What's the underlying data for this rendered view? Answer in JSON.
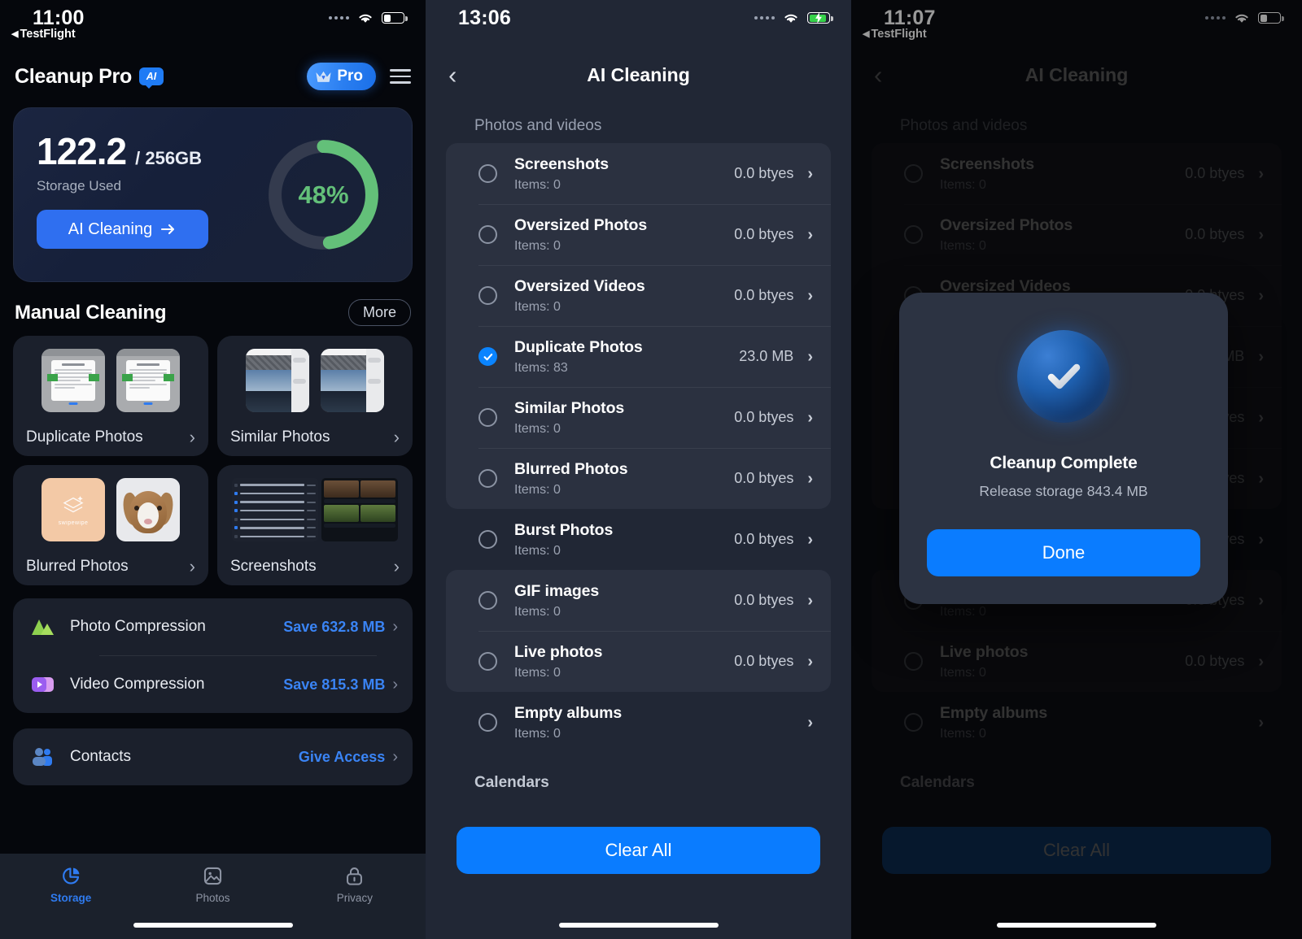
{
  "panel1": {
    "status": {
      "time": "11:00",
      "back_app": "TestFlight"
    },
    "header": {
      "app_title": "Cleanup Pro",
      "ai_badge": "AI",
      "pro_label": "Pro"
    },
    "storage": {
      "used": "122.2",
      "total": "/ 256GB",
      "label": "Storage Used",
      "cta": "AI Cleaning",
      "percent_text": "48%",
      "percent_value": 48,
      "ring_color": "#63c079"
    },
    "manual": {
      "title": "Manual Cleaning",
      "more": "More",
      "cards": [
        {
          "label": "Duplicate Photos",
          "art": "doc"
        },
        {
          "label": "Similar Photos",
          "art": "similar"
        },
        {
          "label": "Blurred Photos",
          "art": "blurred"
        },
        {
          "label": "Screenshots",
          "art": "screenshots"
        }
      ]
    },
    "compression": [
      {
        "label": "Photo Compression",
        "value": "Save 632.8 MB",
        "icon": "mountain-icon"
      },
      {
        "label": "Video Compression",
        "value": "Save 815.3 MB",
        "icon": "video-icon"
      }
    ],
    "contacts": {
      "label": "Contacts",
      "value": "Give Access",
      "icon": "people-icon"
    },
    "tabs": [
      {
        "label": "Storage",
        "icon": "pie-chart-icon",
        "active": true
      },
      {
        "label": "Photos",
        "icon": "photo-icon",
        "active": false
      },
      {
        "label": "Privacy",
        "icon": "lock-icon",
        "active": false
      }
    ]
  },
  "panel2": {
    "status": {
      "time": "13:06",
      "back_app": ""
    },
    "nav": {
      "title": "AI Cleaning"
    },
    "group_photos": "Photos and videos",
    "group_calendars": "Calendars",
    "items": [
      {
        "name": "Screenshots",
        "sub": "Items: 0",
        "size": "0.0 btyes",
        "checked": false
      },
      {
        "name": "Oversized Photos",
        "sub": "Items: 0",
        "size": "0.0 btyes",
        "checked": false
      },
      {
        "name": "Oversized Videos",
        "sub": "Items: 0",
        "size": "0.0 btyes",
        "checked": false
      },
      {
        "name": "Duplicate Photos",
        "sub": "Items: 83",
        "size": "23.0 MB",
        "checked": true
      },
      {
        "name": "Similar Photos",
        "sub": "Items: 0",
        "size": "0.0 btyes",
        "checked": false
      },
      {
        "name": "Blurred Photos",
        "sub": "Items: 0",
        "size": "0.0 btyes",
        "checked": false
      },
      {
        "name": "Burst Photos",
        "sub": "Items: 0",
        "size": "0.0 btyes",
        "checked": false
      },
      {
        "name": "GIF images",
        "sub": "Items: 0",
        "size": "0.0 btyes",
        "checked": false
      },
      {
        "name": "Live photos",
        "sub": "Items: 0",
        "size": "0.0 btyes",
        "checked": false
      },
      {
        "name": "Empty albums",
        "sub": "Items: 0",
        "size": "",
        "checked": false
      }
    ],
    "clear_all": "Clear All"
  },
  "panel3": {
    "status": {
      "time": "11:07",
      "back_app": "TestFlight"
    },
    "nav": {
      "title": "AI Cleaning"
    },
    "modal": {
      "title": "Cleanup Complete",
      "subtitle": "Release storage 843.4 MB",
      "button": "Done",
      "icon": "check-circle-icon"
    }
  },
  "colors": {
    "accent": "#0a7cff",
    "brand_blue": "#2f6ff0",
    "green": "#63c079",
    "link": "#3a84f5"
  }
}
